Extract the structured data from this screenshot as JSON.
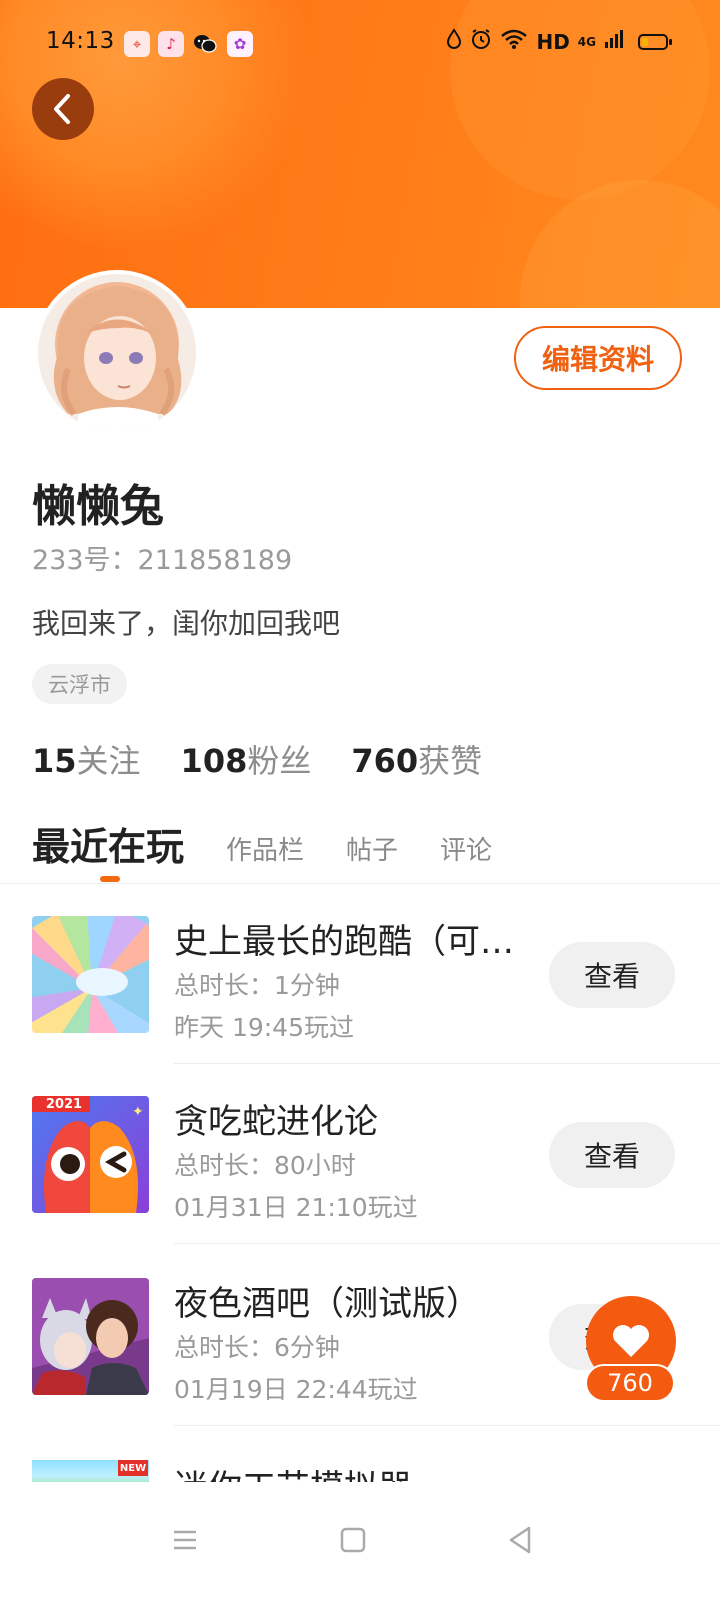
{
  "status_bar": {
    "time": "14:13",
    "network_hd": "HD",
    "network_gen": "4G",
    "battery_level": 0.25,
    "notification_icons": [
      "maps-app-icon",
      "music-app-icon",
      "wechat-icon",
      "game-app-icon"
    ]
  },
  "header": {
    "back_icon": "back-chevron-icon",
    "edit_profile_label": "编辑资料"
  },
  "profile": {
    "name": "懒懒兔",
    "id_line": "233号：211858189",
    "bio": "我回来了，闺你加回我吧",
    "location": "云浮市"
  },
  "stats": [
    {
      "value": "15",
      "label": "关注"
    },
    {
      "value": "108",
      "label": "粉丝"
    },
    {
      "value": "760",
      "label": "获赞"
    }
  ],
  "tabs": [
    {
      "label": "最近在玩",
      "active": true
    },
    {
      "label": "作品栏",
      "active": false
    },
    {
      "label": "帖子",
      "active": false
    },
    {
      "label": "评论",
      "active": false
    }
  ],
  "games": [
    {
      "name": "史上最长的跑酷（可…",
      "duration": "总时长：1分钟",
      "last_played": "昨天 19:45玩过",
      "button": "查看"
    },
    {
      "name": "贪吃蛇进化论",
      "duration": "总时长：80小时",
      "last_played": "01月31日 21:10玩过",
      "button": "查看",
      "badge": "2021"
    },
    {
      "name": "夜色酒吧（测试版）",
      "duration": "总时长：6分钟",
      "last_played": "01月19日 22:44玩过",
      "button": "查看"
    },
    {
      "name": "迷你工艺模拟器",
      "badge": "NEW"
    }
  ],
  "like_fab": {
    "count": "760",
    "icon": "heart-icon"
  },
  "colors": {
    "accent": "#f06112",
    "header": "#ff7a18"
  }
}
